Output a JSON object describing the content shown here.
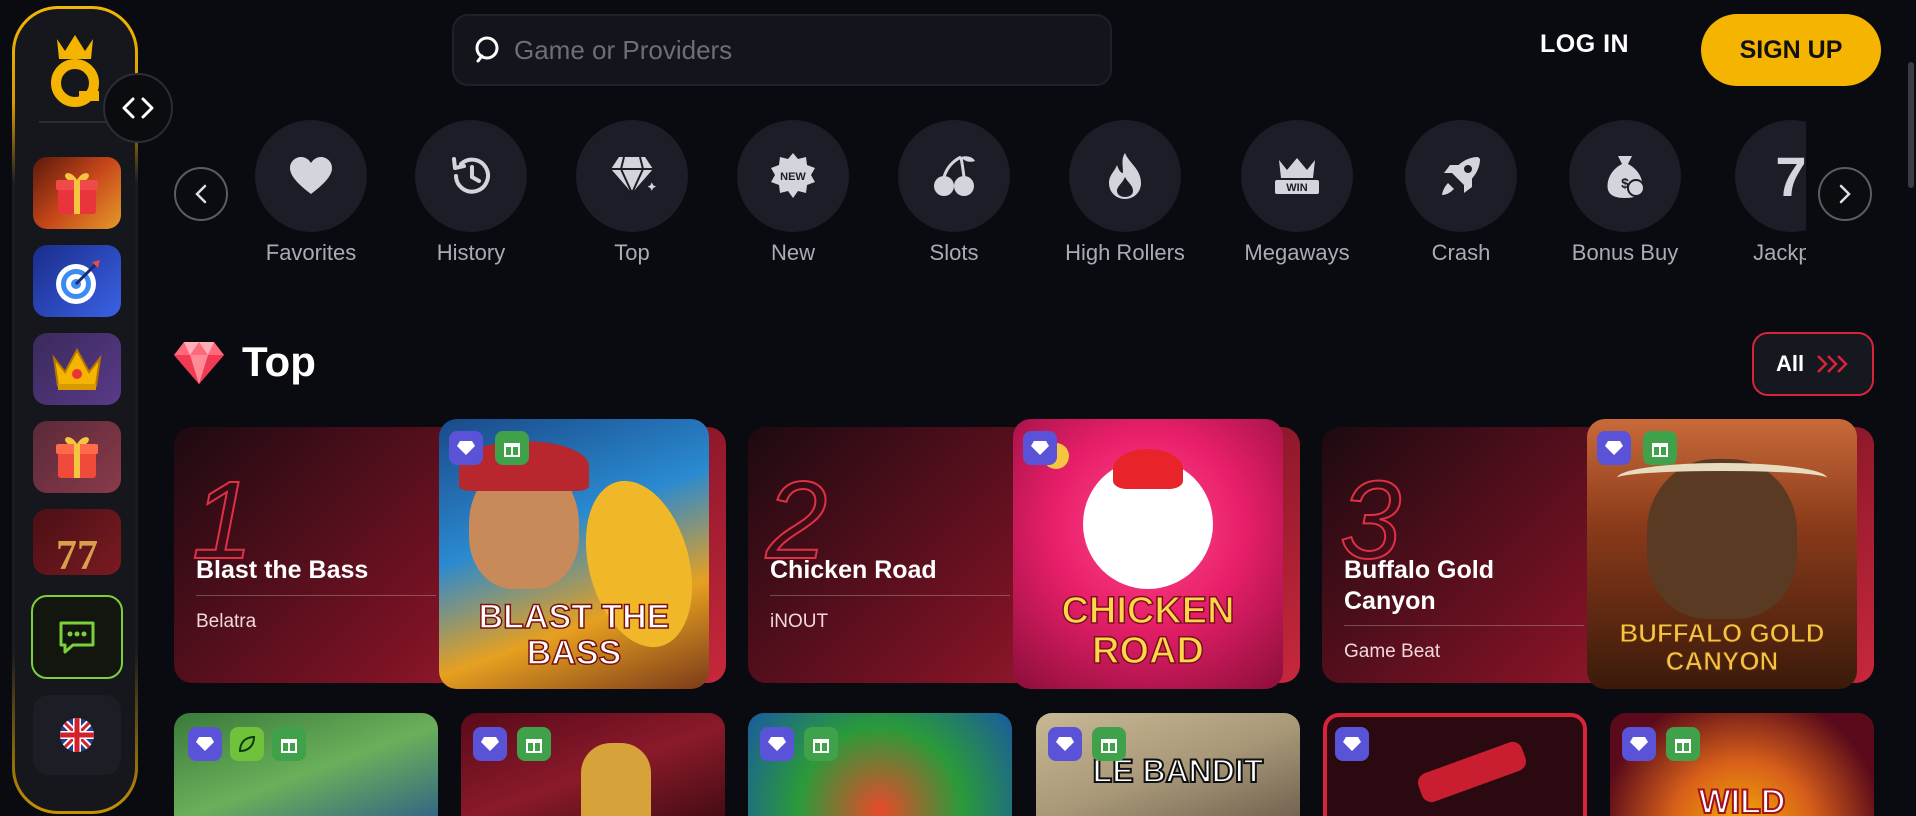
{
  "search": {
    "placeholder": "Game or Providers"
  },
  "auth": {
    "login_label": "LOG IN",
    "signup_label": "SIGN UP"
  },
  "colors": {
    "accent": "#f5b400",
    "background": "#0a0b10",
    "card_red": "#c8283c",
    "chat_green": "#7bd13a"
  },
  "categories": [
    {
      "label": "Favorites",
      "icon": "heart-icon"
    },
    {
      "label": "History",
      "icon": "history-icon"
    },
    {
      "label": "Top",
      "icon": "diamond-icon"
    },
    {
      "label": "New",
      "icon": "new-badge-icon"
    },
    {
      "label": "Slots",
      "icon": "cherry-icon"
    },
    {
      "label": "High Rollers",
      "icon": "flame-icon"
    },
    {
      "label": "Megaways",
      "icon": "win-crown-icon"
    },
    {
      "label": "Crash",
      "icon": "rocket-icon"
    },
    {
      "label": "Bonus Buy",
      "icon": "money-bag-icon"
    },
    {
      "label": "Jackpot",
      "icon": "seven-icon"
    }
  ],
  "top_section": {
    "title": "Top",
    "all_label": "All",
    "cards": [
      {
        "rank": "1",
        "title": "Blast the Bass",
        "provider": "Belatra",
        "art_text": "BLAST THE BASS"
      },
      {
        "rank": "2",
        "title": "Chicken Road",
        "provider": "iNOUT",
        "art_text": "CHICKEN ROAD"
      },
      {
        "rank": "3",
        "title": "Buffalo Gold Canyon",
        "provider": "Game Beat",
        "art_text": "BUFFALO GOLD CANYON"
      }
    ]
  },
  "bottom_tiles": [
    {
      "name": "bass-fishing-tile"
    },
    {
      "name": "train-tile"
    },
    {
      "name": "apple-tile"
    },
    {
      "name": "le-bandit-tile",
      "art_text": "LE BANDIT"
    },
    {
      "name": "crash-plane-tile"
    },
    {
      "name": "wild-wheel-tile",
      "art_text": "WILD"
    }
  ]
}
